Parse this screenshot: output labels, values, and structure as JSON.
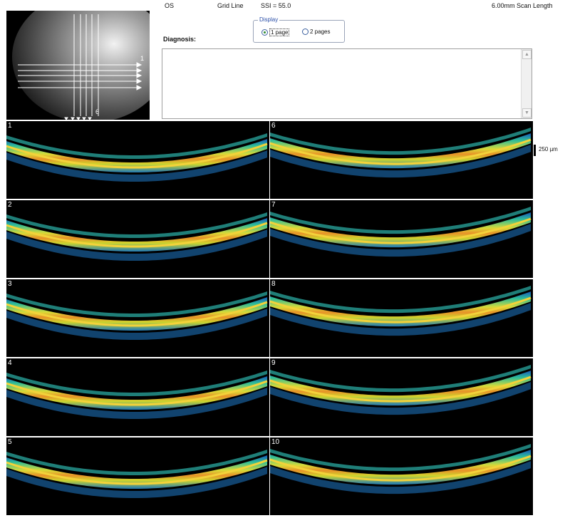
{
  "header": {
    "eye": "OS",
    "scan_mode": "Grid Line",
    "ssi": "SSI = 55.0",
    "scan_length": "6.00mm Scan Length"
  },
  "fundus": {
    "label_horizontal_start": "1",
    "label_vertical_start": "6"
  },
  "display": {
    "group_label": "Display",
    "options": [
      "1 page",
      "2 pages"
    ],
    "selected": "1 page"
  },
  "diagnosis": {
    "label": "Diagnosis:",
    "text": ""
  },
  "scale": {
    "label": "250 µm"
  },
  "scans": [
    {
      "number": "1"
    },
    {
      "number": "2"
    },
    {
      "number": "3"
    },
    {
      "number": "4"
    },
    {
      "number": "5"
    },
    {
      "number": "6"
    },
    {
      "number": "7"
    },
    {
      "number": "8"
    },
    {
      "number": "9"
    },
    {
      "number": "10"
    }
  ]
}
